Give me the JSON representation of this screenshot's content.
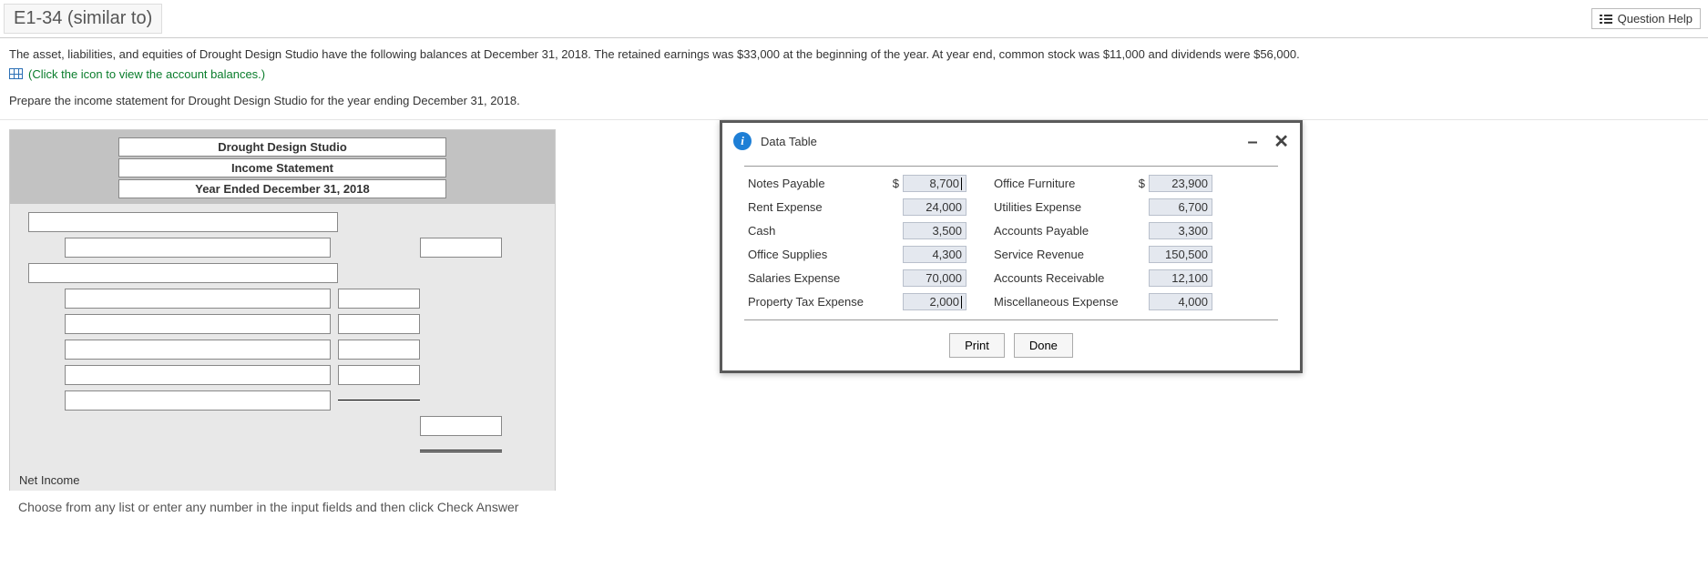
{
  "header": {
    "title": "E1-34 (similar to)",
    "help_label": "Question Help"
  },
  "prompt": {
    "line1": "The asset, liabilities, and equities of Drought Design Studio have the following balances at December 31, 2018. The retained earnings was $33,000 at the beginning of the year. At year end, common stock was $11,000 and dividends were $56,000.",
    "click_link": "(Click the icon to view the account balances.)",
    "instruction": "Prepare the income statement for Drought Design Studio for the year ending December 31, 2018."
  },
  "worksheet": {
    "h1": "Drought Design Studio",
    "h2": "Income Statement",
    "h3": "Year Ended December 31, 2018",
    "net_label": "Net Income"
  },
  "popup": {
    "title": "Data Table",
    "print": "Print",
    "done": "Done",
    "rows": [
      {
        "l": "Notes Payable",
        "ls": "$",
        "lv": "8,700",
        "r": "Office Furniture",
        "rs": "$",
        "rv": "23,900"
      },
      {
        "l": "Rent Expense",
        "ls": "",
        "lv": "24,000",
        "r": "Utilities Expense",
        "rs": "",
        "rv": "6,700"
      },
      {
        "l": "Cash",
        "ls": "",
        "lv": "3,500",
        "r": "Accounts Payable",
        "rs": "",
        "rv": "3,300"
      },
      {
        "l": "Office Supplies",
        "ls": "",
        "lv": "4,300",
        "r": "Service Revenue",
        "rs": "",
        "rv": "150,500"
      },
      {
        "l": "Salaries Expense",
        "ls": "",
        "lv": "70,000",
        "r": "Accounts Receivable",
        "rs": "",
        "rv": "12,100"
      },
      {
        "l": "Property Tax Expense",
        "ls": "",
        "lv": "2,000",
        "r": "Miscellaneous Expense",
        "rs": "",
        "rv": "4,000"
      }
    ]
  },
  "footer_hint": "Choose from any list or enter any number in the input fields and then click Check Answer"
}
